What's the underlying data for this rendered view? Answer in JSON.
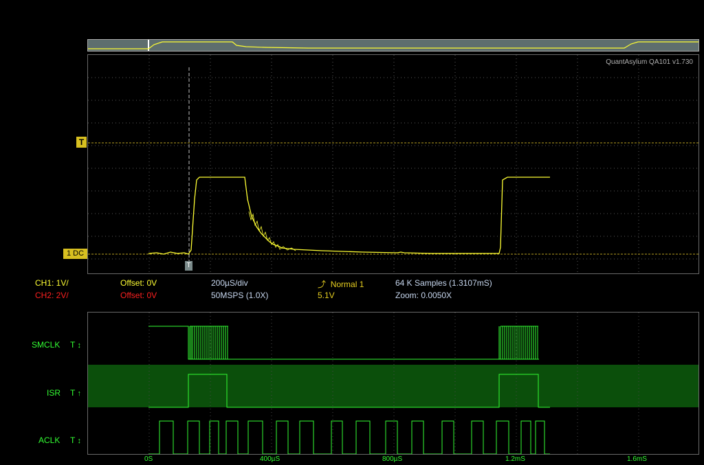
{
  "app": {
    "title": "QuantAsylum QA101 v1.730"
  },
  "colors": {
    "ch1": "#ffff33",
    "ch2": "#ff2020",
    "info": "#c8d8f0",
    "trigger_text": "#e8d020",
    "logic": "#33ff33",
    "logic_highlight": "#0b4f0b",
    "grid": "#5a5a5a",
    "overview_bg": "#5e6e6e"
  },
  "scope": {
    "trigger_marker_label": "T",
    "ch1_marker_label": "1 DC",
    "trigger_position_label": "T"
  },
  "status": {
    "ch1_scale": "CH1: 1V/",
    "ch2_scale": "CH2: 2V/",
    "ch1_offset": "Offset: 0V",
    "ch2_offset": "Offset: 0V",
    "timebase": "200µS/div",
    "sample_rate": "50MSPS (1.0X)",
    "trigger_icon": "rising-edge-icon",
    "trigger_mode": "Normal 1",
    "trigger_level": "5.1V",
    "samples": "64 K Samples (1.3107mS)",
    "zoom": "Zoom: 0.0050X"
  },
  "logic": {
    "channels": [
      {
        "name": "SMCLK",
        "trig": "T",
        "trig_icon": "either-edge-icon",
        "trig_symbol": "↕"
      },
      {
        "name": "ISR",
        "trig": "T",
        "trig_icon": "rising-arrow-icon",
        "trig_symbol": "↑"
      },
      {
        "name": "ACLK",
        "trig": "T",
        "trig_icon": "either-edge-icon",
        "trig_symbol": "↕"
      }
    ],
    "time_axis": [
      "0S",
      "400µS",
      "800µS",
      "1.2mS",
      "1.6mS"
    ]
  }
}
